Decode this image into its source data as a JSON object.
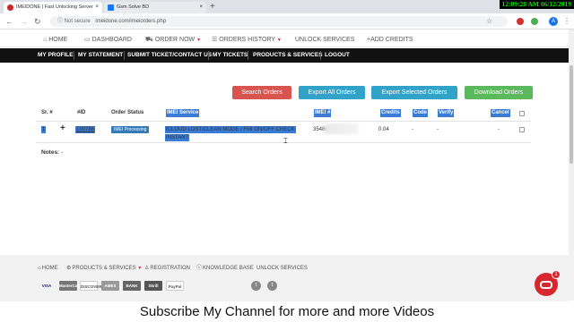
{
  "browser": {
    "tabs": [
      {
        "title": "IMEIDONE | Fast Unlocking Server",
        "close": "×",
        "active": true
      },
      {
        "title": "Gsm Solve BD",
        "close": "×",
        "active": false
      }
    ],
    "new_tab": "+",
    "clock": "12:09:28 AM 06/12/2019",
    "back": "←",
    "forward": "→",
    "reload": "↻",
    "not_secure": "ⓘ Not secure",
    "url": "imeidone.com/imeiorders.php",
    "avatar_letter": "A",
    "icons": [
      "star-icon",
      "extension-icon",
      "menu-icon"
    ]
  },
  "topnav": {
    "home": "HOME",
    "dashboard": "DASHBOARD",
    "order_now": "ORDER NOW",
    "orders_history": "ORDERS HISTORY",
    "unlock_services": "UNLOCK SERVICES",
    "add_credits": "+ADD CREDITS"
  },
  "secondary_nav": [
    "MY PROFILE",
    "MY STATEMENT",
    "SUBMIT TICKET/CONTACT US",
    "MY TICKETS",
    "PRODUCTS & SERVICES",
    "LOGOUT"
  ],
  "actions": {
    "search_orders": "Search Orders",
    "export_all": "Export All Orders",
    "export_selected": "Export Selected Orders",
    "download": "Download Orders"
  },
  "table": {
    "headers": {
      "sr": "Sr. #",
      "id": "#ID",
      "status": "Order Status",
      "service": "IMEI Service",
      "imei": "IMEI #",
      "credits": "Credits",
      "code": "Code",
      "verify": "Verify",
      "cancel": "Cancel"
    },
    "rows": [
      {
        "sr": "1",
        "expand": "+",
        "id": "100786",
        "status": "IMEI Processing",
        "service_line1": "ICLOUD LOST/CLEAN MODE / FMI ON/OFF CHECK",
        "service_line2": "INSTANT",
        "imei": "35486",
        "credits": "0.04",
        "code": "-",
        "verify": "-",
        "cancel": "-"
      }
    ]
  },
  "notes": {
    "label": "Notes:",
    "value": "-"
  },
  "footer": {
    "links": [
      "HOME",
      "PRODUCTS & SERVICES",
      "REGISTRATION",
      "KNOWLEDGE BASE",
      "UNLOCK SERVICES"
    ],
    "payments": [
      "VISA",
      "MasterCard",
      "DISCOVER",
      "AMEX",
      "BANK",
      "Skrill",
      "PayPal"
    ]
  },
  "chat": {
    "badge": "1"
  },
  "caption": "Subscribe My Channel for more and more Videos"
}
